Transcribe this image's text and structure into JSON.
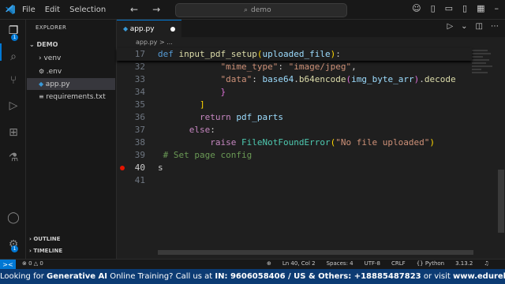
{
  "menu": [
    "File",
    "Edit",
    "Selection"
  ],
  "search": {
    "text": "demo"
  },
  "sidebar": {
    "title": "EXPLORER",
    "folder": "DEMO",
    "items": [
      {
        "label": "venv",
        "icon": "chevron-right-icon"
      },
      {
        "label": ".env",
        "icon": "gear-icon"
      },
      {
        "label": "app.py",
        "icon": "python-icon"
      },
      {
        "label": "requirements.txt",
        "icon": "file-icon"
      }
    ],
    "outline": "OUTLINE",
    "timeline": "TIMELINE"
  },
  "editor": {
    "tab_label": "app.py",
    "breadcrumb": "app.py > ...",
    "lines": [
      {
        "no": "17",
        "segments": [
          {
            "c": "kw",
            "t": "def "
          },
          {
            "c": "fn",
            "t": "input_pdf_setup"
          },
          {
            "c": "brk",
            "t": "("
          },
          {
            "c": "var",
            "t": "uploaded_file"
          },
          {
            "c": "brk",
            "t": ")"
          },
          {
            "c": "",
            "t": ":"
          }
        ]
      },
      {
        "no": "32",
        "segments": [
          {
            "c": "",
            "t": "            "
          },
          {
            "c": "str",
            "t": "\"mime_type\""
          },
          {
            "c": "",
            "t": ": "
          },
          {
            "c": "str",
            "t": "\"image/jpeg\""
          },
          {
            "c": "",
            "t": ","
          }
        ]
      },
      {
        "no": "33",
        "segments": [
          {
            "c": "",
            "t": "            "
          },
          {
            "c": "str",
            "t": "\"data\""
          },
          {
            "c": "",
            "t": ": "
          },
          {
            "c": "var",
            "t": "base64"
          },
          {
            "c": "",
            "t": "."
          },
          {
            "c": "fn",
            "t": "b64encode"
          },
          {
            "c": "brk2",
            "t": "("
          },
          {
            "c": "var",
            "t": "img_byte_arr"
          },
          {
            "c": "brk2",
            "t": ")"
          },
          {
            "c": "",
            "t": "."
          },
          {
            "c": "fn",
            "t": "decode"
          }
        ]
      },
      {
        "no": "34",
        "segments": [
          {
            "c": "",
            "t": "            "
          },
          {
            "c": "brk2",
            "t": "}"
          }
        ]
      },
      {
        "no": "35",
        "segments": [
          {
            "c": "",
            "t": "        "
          },
          {
            "c": "brk",
            "t": "]"
          }
        ]
      },
      {
        "no": "36",
        "segments": [
          {
            "c": "",
            "t": "        "
          },
          {
            "c": "kw2",
            "t": "return "
          },
          {
            "c": "var",
            "t": "pdf_parts"
          }
        ]
      },
      {
        "no": "37",
        "segments": [
          {
            "c": "",
            "t": "      "
          },
          {
            "c": "kw2",
            "t": "else"
          },
          {
            "c": "",
            "t": ":"
          }
        ]
      },
      {
        "no": "38",
        "segments": [
          {
            "c": "",
            "t": "          "
          },
          {
            "c": "kw2",
            "t": "raise "
          },
          {
            "c": "cls",
            "t": "FileNotFoundError"
          },
          {
            "c": "brk",
            "t": "("
          },
          {
            "c": "str",
            "t": "\"No file uploaded\""
          },
          {
            "c": "brk",
            "t": ")"
          }
        ]
      },
      {
        "no": "39",
        "segments": [
          {
            "c": "cmt",
            "t": " # Set page config"
          }
        ]
      },
      {
        "no": "40",
        "segments": [
          {
            "c": "",
            "t": "s"
          }
        ],
        "current": true
      },
      {
        "no": "41",
        "segments": []
      }
    ]
  },
  "status": {
    "remote": "><",
    "problems": "⊗ 0 △ 0",
    "right": [
      "Ln 40, Col 2",
      "Spaces: 4",
      "UTF-8",
      "CRLF",
      "{} Python",
      "3.13.2"
    ]
  },
  "banner": {
    "pre": "Looking for ",
    "bold1": "Generative AI",
    "mid": " Online Training? Call us at ",
    "bold2": "IN: 9606058406 / US & Others: +18885487823",
    "post": " or visit ",
    "bold3": "www.edureka.co"
  },
  "colors": {
    "accent": "#0078d4",
    "banner": "#0c3b73",
    "breakpoint": "#e51400"
  }
}
